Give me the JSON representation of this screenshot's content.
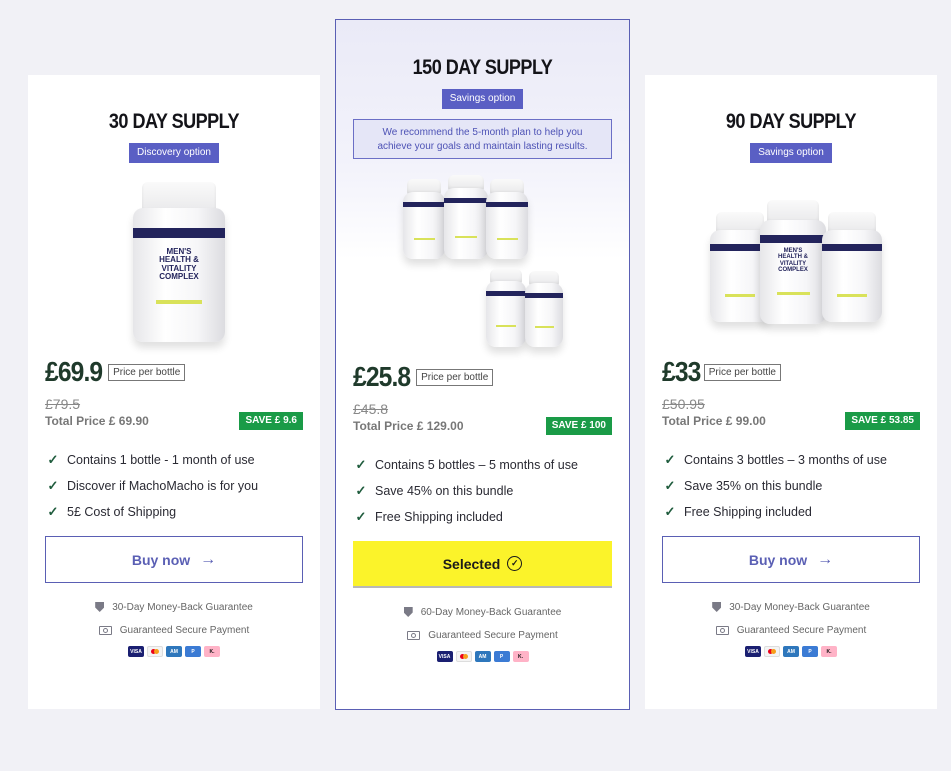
{
  "plans": [
    {
      "id": "30",
      "title": "30 DAY SUPPLY",
      "badge": "Discovery option",
      "price": "£69.9",
      "price_per_bottle_label": "Price per bottle",
      "old_price": "£79.5",
      "total": "Total Price £ 69.90",
      "save": "SAVE £ 9.6",
      "features": [
        "Contains 1 bottle - 1 month of use",
        "Discover if MachoMacho is for you",
        "5£ Cost of Shipping"
      ],
      "button": "Buy now",
      "guarantee": "30-Day Money-Back Guarantee",
      "secure": "Guaranteed Secure Payment"
    },
    {
      "id": "150",
      "title": "150 DAY SUPPLY",
      "badge": "Savings option",
      "recommendation": "We recommend the 5-month plan to help you achieve your goals and maintain lasting results.",
      "price": "£25.8",
      "price_per_bottle_label": "Price per bottle",
      "old_price": "£45.8",
      "total": "Total Price £ 129.00",
      "save": "SAVE £ 100",
      "features": [
        "Contains 5 bottles – 5 months of use",
        "Save 45% on this bundle",
        "Free Shipping included"
      ],
      "button": "Selected",
      "guarantee": "60-Day Money-Back Guarantee",
      "secure": "Guaranteed Secure Payment"
    },
    {
      "id": "90",
      "title": "90 DAY SUPPLY",
      "badge": "Savings option",
      "price": "£33",
      "price_per_bottle_label": "Price per bottle",
      "old_price": "£50.95",
      "total": "Total Price £ 99.00",
      "save": "SAVE £ 53.85",
      "features": [
        "Contains 3 bottles – 3 months of use",
        "Save 35% on this bundle",
        "Free Shipping included"
      ],
      "button": "Buy now",
      "guarantee": "30-Day Money-Back Guarantee",
      "secure": "Guaranteed Secure Payment"
    }
  ],
  "bottle_label": {
    "brand": "MachoMacho",
    "line1": "MEN'S",
    "line2": "HEALTH &",
    "line3": "VITALITY",
    "line4": "COMPLEX"
  },
  "payment_methods": [
    "visa-icon",
    "mastercard-icon",
    "amex-icon",
    "paypal-icon",
    "klarna-icon"
  ],
  "colors": {
    "accent": "#5a5fc4",
    "save_green": "#1a9b47",
    "selected_yellow": "#fbf32a",
    "price_green": "#1f3a2b"
  }
}
